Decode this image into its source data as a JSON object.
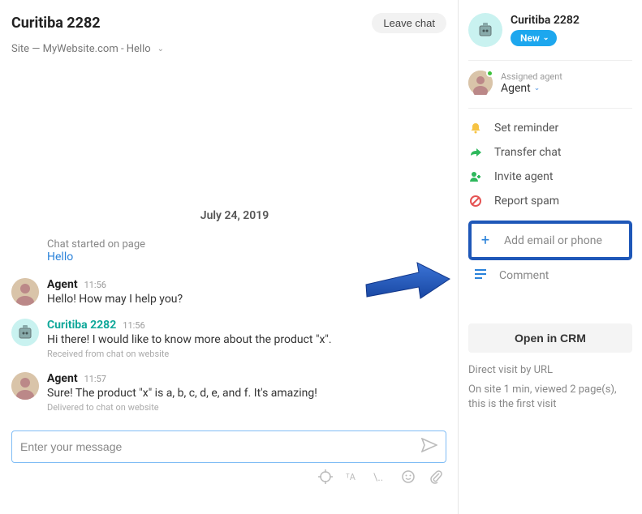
{
  "header": {
    "title": "Curitiba 2282",
    "leave_label": "Leave chat",
    "breadcrumb": "Site — MyWebsite.com - Hello"
  },
  "date_separator": "July 24, 2019",
  "system": {
    "label": "Chat started on page",
    "link_text": "Hello"
  },
  "messages": [
    {
      "author": "Agent",
      "author_type": "agent",
      "time": "11:56",
      "text": "Hello! How may I help you?",
      "meta": ""
    },
    {
      "author": "Curitiba 2282",
      "author_type": "visitor",
      "time": "11:56",
      "text": "Hi there! I would like to know more about the product \"x\".",
      "meta": "Received from chat on website"
    },
    {
      "author": "Agent",
      "author_type": "agent",
      "time": "11:57",
      "text": "Sure! The product \"x\" is a, b, c, d, e, and f. It's amazing!",
      "meta": "Delivered to chat on website"
    }
  ],
  "composer": {
    "placeholder": "Enter your message"
  },
  "sidebar": {
    "contact_name": "Curitiba 2282",
    "status_badge": "New",
    "assigned_label": "Assigned agent",
    "assigned_name": "Agent",
    "actions": {
      "reminder": "Set reminder",
      "transfer": "Transfer chat",
      "invite": "Invite agent",
      "report": "Report spam"
    },
    "add_contact": "Add email or phone",
    "comment": "Comment",
    "open_crm": "Open in CRM",
    "visit_source": "Direct visit by URL",
    "visit_detail": "On site 1 min, viewed 2 page(s), this is the first visit"
  },
  "icons": {
    "bell": "bell-icon",
    "forward": "forward-icon",
    "invite": "user-plus-icon",
    "ban": "ban-icon",
    "plus": "plus-icon",
    "comment": "lines-icon"
  }
}
